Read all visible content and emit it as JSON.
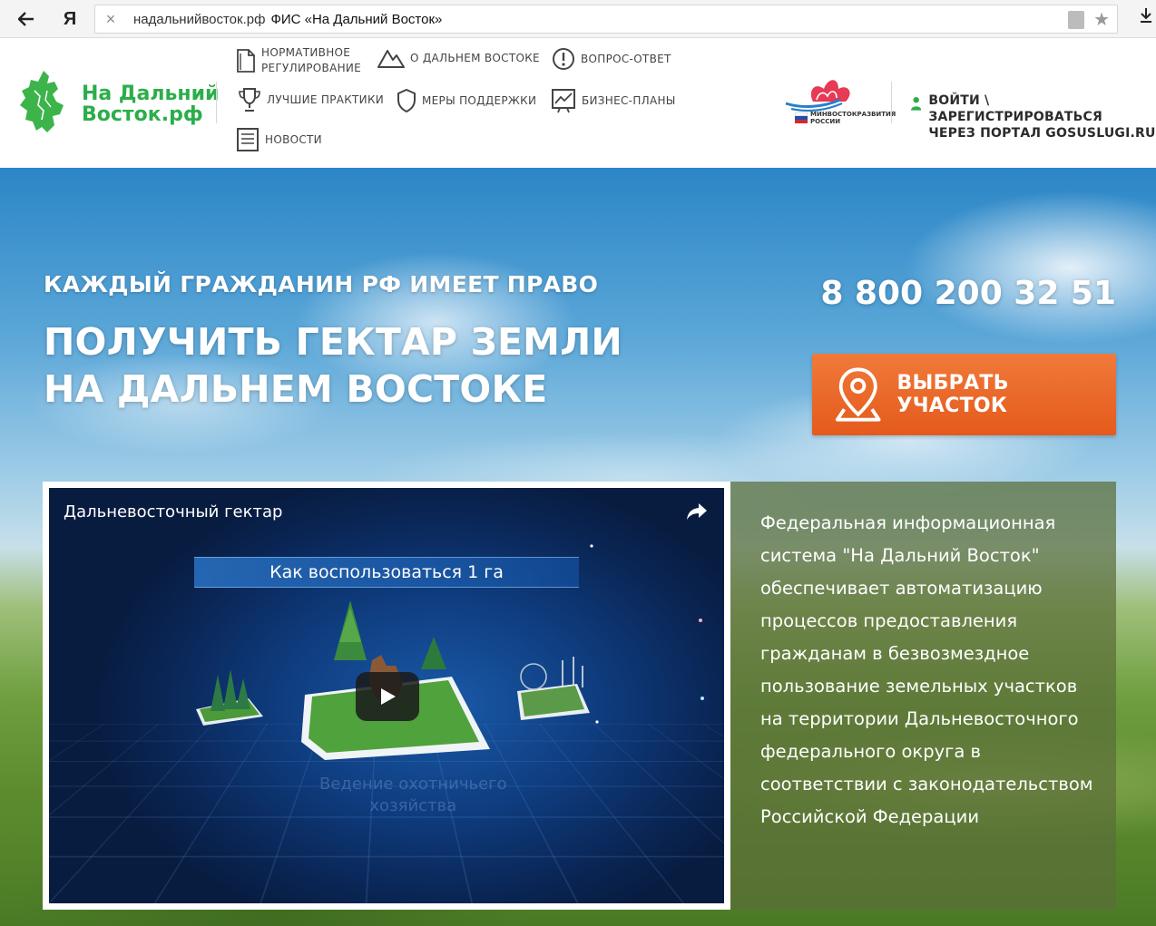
{
  "browser": {
    "back_icon": "arrow-left-icon",
    "yandex_label": "Я",
    "close_glyph": "×",
    "url": "надальнийвосток.рф",
    "page_title": "ФИС «На Дальний Восток»"
  },
  "header": {
    "brand_line1": "На Дальний",
    "brand_line2": "Восток.рф",
    "nav": {
      "normative": "НОРМАТИВНОЕ РЕГУЛИРОВАНИЕ",
      "about": "О ДАЛЬНЕМ ВОСТОКЕ",
      "faq": "ВОПРОС-ОТВЕТ",
      "practices": "ЛУЧШИЕ ПРАКТИКИ",
      "support": "МЕРЫ ПОДДЕРЖКИ",
      "business": "БИЗНЕС-ПЛАНЫ",
      "news": "НОВОСТИ"
    },
    "ministry_line1": "МИНВОСТОКРАЗВИТИЯ",
    "ministry_line2": "РОССИИ",
    "login_line1": "ВОЙТИ \\ ЗАРЕГИСТРИРОВАТЬСЯ",
    "login_line2": "ЧЕРЕЗ ПОРТАЛ GOSUSLUGI.RU"
  },
  "hero": {
    "subtitle": "КАЖДЫЙ ГРАЖДАНИН РФ ИМЕЕТ ПРАВО",
    "title_line1": "ПОЛУЧИТЬ ГЕКТАР ЗЕМЛИ",
    "title_line2": "НА ДАЛЬНЕМ ВОСТОКЕ",
    "phone": "8 800 200 32 51",
    "choose_button": "ВЫБРАТЬ УЧАСТОК"
  },
  "video": {
    "title": "Дальневосточный гектар",
    "banner": "Как воспользоваться 1 га",
    "ghost_line1": "Ведение охотничьего",
    "ghost_line2": "хозяйства"
  },
  "info": {
    "text": "Федеральная информационная система \"На Дальний Восток\" обеспечивает автоматизацию процессов предоставления гражданам в безвозмездное пользование земельных участков на территории Дальневосточного федерального округа в соответствии с законодательством Российской Федерации"
  },
  "colors": {
    "brand_green": "#2bae4a",
    "button_orange": "#e8622a",
    "panel_olive": "#5a6e37"
  }
}
